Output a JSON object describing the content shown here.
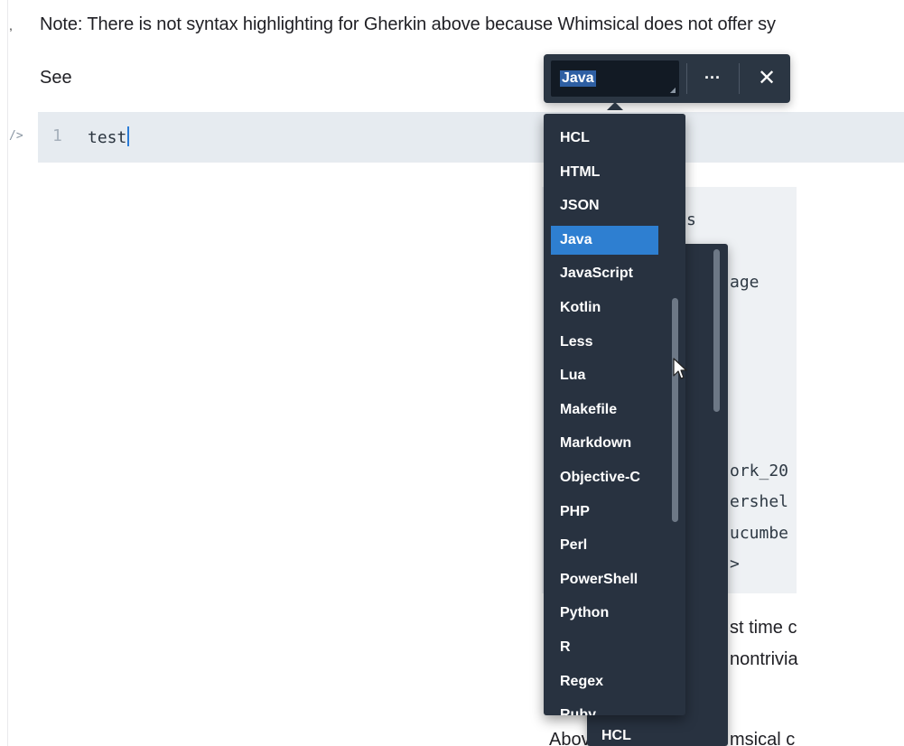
{
  "note": {
    "text": "Note: There is not syntax highlighting for Gherkin above because Whimsical does not offer sy"
  },
  "see": {
    "text": "See"
  },
  "code_block": {
    "gutter_icon": "/>",
    "line_number": "1",
    "line_text": "test"
  },
  "toolbar": {
    "language_value": "Java",
    "more_label": "···",
    "close_label": "✕"
  },
  "dropdown": {
    "items": [
      {
        "label": "HCL",
        "selected": false
      },
      {
        "label": "HTML",
        "selected": false
      },
      {
        "label": "JSON",
        "selected": false
      },
      {
        "label": "Java",
        "selected": true
      },
      {
        "label": "JavaScript",
        "selected": false
      },
      {
        "label": "Kotlin",
        "selected": false
      },
      {
        "label": "Less",
        "selected": false
      },
      {
        "label": "Lua",
        "selected": false
      },
      {
        "label": "Makefile",
        "selected": false
      },
      {
        "label": "Markdown",
        "selected": false
      },
      {
        "label": "Objective-C",
        "selected": false
      },
      {
        "label": "PHP",
        "selected": false
      },
      {
        "label": "Perl",
        "selected": false
      },
      {
        "label": "PowerShell",
        "selected": false
      },
      {
        "label": "Python",
        "selected": false
      },
      {
        "label": "R",
        "selected": false
      },
      {
        "label": "Regex",
        "selected": false
      },
      {
        "label": "Ruby",
        "selected": false
      }
    ]
  },
  "back_dropdown": {
    "visible_item": "HCL"
  },
  "background": {
    "mono_fragments": [
      "s",
      "age",
      "ork_20",
      "ershel",
      "ucumbe",
      ">"
    ],
    "prose_fragments": [
      "st time c",
      "nontrivia",
      "Abov",
      "msical c"
    ]
  },
  "colors": {
    "dropdown_bg": "#283240",
    "selected_bg": "#2e7fd1",
    "code_block_bg": "#e6ebf0",
    "select_bg": "#121a24"
  },
  "icons": {
    "more": "ellipsis-icon",
    "close": "close-icon",
    "gutter": "code-icon",
    "cursor": "mouse-pointer-icon"
  }
}
